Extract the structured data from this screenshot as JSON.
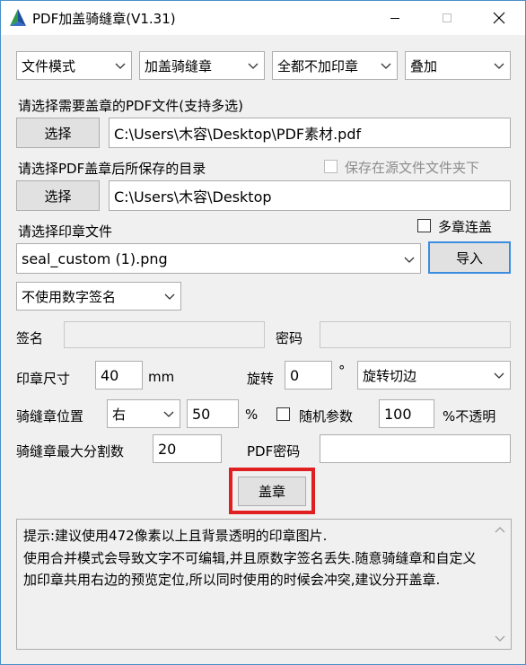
{
  "window": {
    "title": "PDF加盖骑缝章(V1.31)",
    "icons": {
      "app": "app-logo-icon",
      "minimize": "minimize-icon",
      "maximize": "maximize-icon",
      "close": "close-icon"
    }
  },
  "top_selects": {
    "mode": "文件模式",
    "stamp_type": "加盖骑缝章",
    "apply_scope": "全都不加印章",
    "layer": "叠加"
  },
  "pdf_input": {
    "label": "请选择需要盖章的PDF文件(支持多选)",
    "button": "选择",
    "value": "C:\\Users\\木容\\Desktop\\PDF素材.pdf"
  },
  "output_dir": {
    "label": "请选择PDF盖章后所保存的目录",
    "save_in_source_label": "保存在源文件文件夹下",
    "button": "选择",
    "value": "C:\\Users\\木容\\Desktop"
  },
  "seal_file": {
    "label": "请选择印章文件",
    "multi_seal_label": "多章连盖",
    "selected": "seal_custom (1).png",
    "import_button": "导入"
  },
  "digital_signature": {
    "select": "不使用数字签名",
    "signer_label": "签名",
    "signer_value": "",
    "password_label": "密码",
    "password_value": ""
  },
  "stamp_size": {
    "label": "印章尺寸",
    "value": "40",
    "unit": "mm",
    "rotate_label": "旋转",
    "rotate_value": "0",
    "degree_unit": "°",
    "rotate_mode": "旋转切边"
  },
  "position": {
    "label": "骑缝章位置",
    "side": "右",
    "percent_value": "50",
    "percent_unit": "%",
    "random_label": "随机参数",
    "opacity_value": "100",
    "opacity_unit": "%不透明"
  },
  "split": {
    "label": "骑缝章最大分割数",
    "value": "20",
    "pdf_password_label": "PDF密码",
    "pdf_password_value": ""
  },
  "stamp_button": "盖章",
  "hint_text": "提示:建议使用472像素以上且背景透明的印章图片.\n使用合并模式会导致文字不可编辑,并且原数字签名丢失.随意骑缝章和自定义加印章共用右边的预览定位,所以同时使用的时候会冲突,建议分开盖章.",
  "colors": {
    "highlight_border": "#e02020",
    "window_border": "#4a90c8",
    "dialog_bg": "#f0f0f0"
  }
}
